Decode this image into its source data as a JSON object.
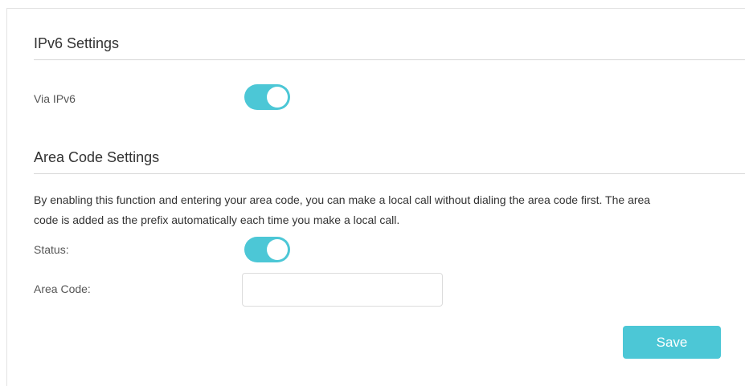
{
  "ipv6_settings": {
    "title": "IPv6 Settings",
    "via_ipv6_label": "Via IPv6",
    "via_ipv6_enabled": true
  },
  "area_code_settings": {
    "title": "Area Code Settings",
    "description_line1": "By enabling this function and entering your area code, you can make a local call without dialing the area code first. The area",
    "description_line2": "code is added as the prefix automatically each time you make a local call.",
    "status_label": "Status:",
    "status_enabled": true,
    "area_code_label": "Area Code:",
    "area_code_value": ""
  },
  "actions": {
    "save_label": "Save"
  },
  "colors": {
    "accent": "#4cc7d6",
    "divider": "#d6d6d6",
    "text": "#333333"
  }
}
